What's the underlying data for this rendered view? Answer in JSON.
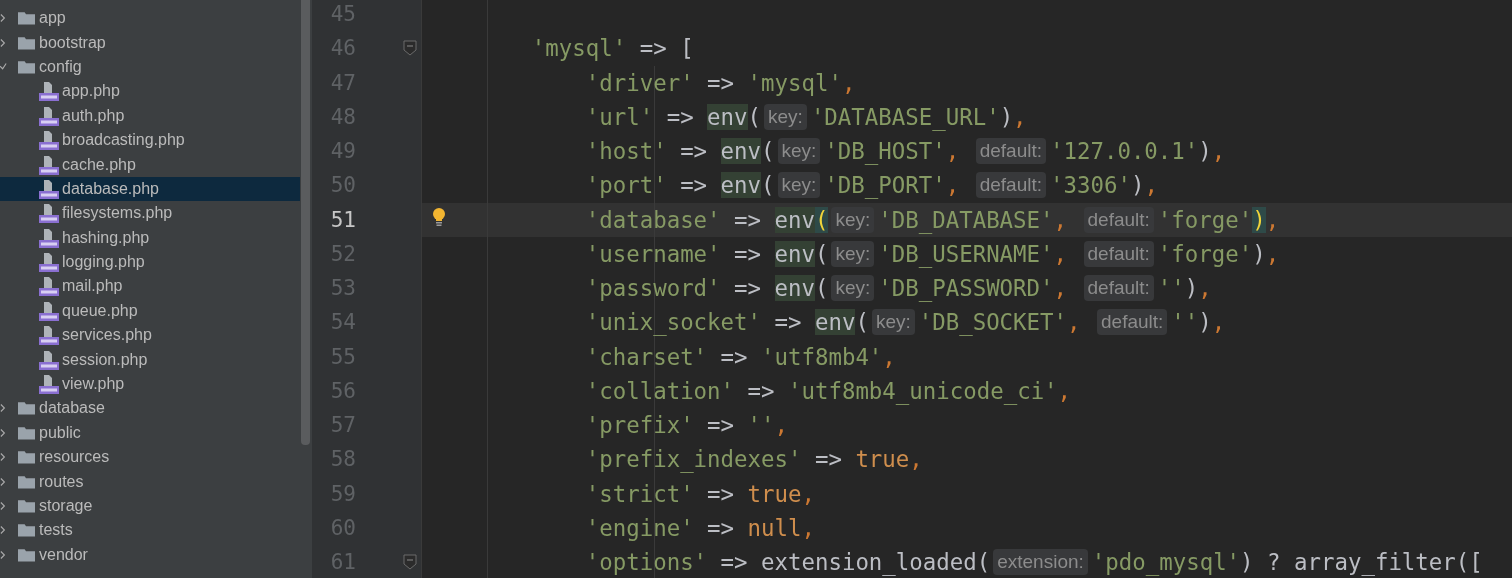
{
  "project_tree": {
    "items": [
      {
        "kind": "folder",
        "label": "app",
        "expanded": false,
        "selected": false
      },
      {
        "kind": "folder",
        "label": "bootstrap",
        "expanded": false,
        "selected": false
      },
      {
        "kind": "folder",
        "label": "config",
        "expanded": true,
        "selected": false,
        "children": [
          {
            "kind": "file",
            "label": "app.php",
            "selected": false
          },
          {
            "kind": "file",
            "label": "auth.php",
            "selected": false
          },
          {
            "kind": "file",
            "label": "broadcasting.php",
            "selected": false
          },
          {
            "kind": "file",
            "label": "cache.php",
            "selected": false
          },
          {
            "kind": "file",
            "label": "database.php",
            "selected": true
          },
          {
            "kind": "file",
            "label": "filesystems.php",
            "selected": false
          },
          {
            "kind": "file",
            "label": "hashing.php",
            "selected": false
          },
          {
            "kind": "file",
            "label": "logging.php",
            "selected": false
          },
          {
            "kind": "file",
            "label": "mail.php",
            "selected": false
          },
          {
            "kind": "file",
            "label": "queue.php",
            "selected": false
          },
          {
            "kind": "file",
            "label": "services.php",
            "selected": false
          },
          {
            "kind": "file",
            "label": "session.php",
            "selected": false
          },
          {
            "kind": "file",
            "label": "view.php",
            "selected": false
          }
        ]
      },
      {
        "kind": "folder",
        "label": "database",
        "expanded": false,
        "selected": false
      },
      {
        "kind": "folder",
        "label": "public",
        "expanded": false,
        "selected": false
      },
      {
        "kind": "folder",
        "label": "resources",
        "expanded": false,
        "selected": false
      },
      {
        "kind": "folder",
        "label": "routes",
        "expanded": false,
        "selected": false
      },
      {
        "kind": "folder",
        "label": "storage",
        "expanded": false,
        "selected": false
      },
      {
        "kind": "folder",
        "label": "tests",
        "expanded": false,
        "selected": false
      },
      {
        "kind": "folder",
        "label": "vendor",
        "expanded": false,
        "selected": false
      }
    ]
  },
  "editor": {
    "lines": [
      {
        "number": "45",
        "current": false,
        "fold_marker": false,
        "bulb": false
      },
      {
        "number": "46",
        "current": false,
        "fold_marker": true,
        "bulb": false,
        "tokens": [
          {
            "kind": "string",
            "text": "        'mysql'"
          },
          {
            "kind": "plain",
            "text": " => ["
          }
        ]
      },
      {
        "number": "47",
        "current": false,
        "fold_marker": false,
        "bulb": false,
        "tokens": [
          {
            "kind": "string",
            "text": "            'driver'"
          },
          {
            "kind": "plain",
            "text": " => "
          },
          {
            "kind": "string",
            "text": "'mysql'"
          },
          {
            "kind": "comma",
            "text": ","
          }
        ]
      },
      {
        "number": "48",
        "current": false,
        "fold_marker": false,
        "bulb": false,
        "tokens": [
          {
            "kind": "string",
            "text": "            'url'"
          },
          {
            "kind": "plain",
            "text": " => "
          },
          {
            "kind": "call",
            "text": "env",
            "highlighted": true
          },
          {
            "kind": "bracket",
            "text": "(",
            "matched": false
          },
          {
            "kind": "hint",
            "text": "key:"
          },
          {
            "kind": "string",
            "text": "'DATABASE_URL'"
          },
          {
            "kind": "bracket",
            "text": ")",
            "matched": false
          },
          {
            "kind": "comma",
            "text": ","
          }
        ]
      },
      {
        "number": "49",
        "current": false,
        "fold_marker": false,
        "bulb": false,
        "tokens": [
          {
            "kind": "string",
            "text": "            'host'"
          },
          {
            "kind": "plain",
            "text": " => "
          },
          {
            "kind": "call",
            "text": "env",
            "highlighted": true
          },
          {
            "kind": "bracket",
            "text": "(",
            "matched": false
          },
          {
            "kind": "hint",
            "text": "key:"
          },
          {
            "kind": "string",
            "text": "'DB_HOST'"
          },
          {
            "kind": "comma",
            "text": ", "
          },
          {
            "kind": "hint",
            "text": "default:"
          },
          {
            "kind": "string",
            "text": "'127.0.0.1'"
          },
          {
            "kind": "bracket",
            "text": ")",
            "matched": false
          },
          {
            "kind": "comma",
            "text": ","
          }
        ]
      },
      {
        "number": "50",
        "current": false,
        "fold_marker": false,
        "bulb": false,
        "tokens": [
          {
            "kind": "string",
            "text": "            'port'"
          },
          {
            "kind": "plain",
            "text": " => "
          },
          {
            "kind": "call",
            "text": "env",
            "highlighted": true
          },
          {
            "kind": "bracket",
            "text": "(",
            "matched": false
          },
          {
            "kind": "hint",
            "text": "key:"
          },
          {
            "kind": "string",
            "text": "'DB_PORT'"
          },
          {
            "kind": "comma",
            "text": ", "
          },
          {
            "kind": "hint",
            "text": "default:"
          },
          {
            "kind": "string",
            "text": "'3306'"
          },
          {
            "kind": "bracket",
            "text": ")",
            "matched": false
          },
          {
            "kind": "comma",
            "text": ","
          }
        ]
      },
      {
        "number": "51",
        "current": true,
        "fold_marker": false,
        "bulb": true,
        "tokens": [
          {
            "kind": "string",
            "text": "            'database'"
          },
          {
            "kind": "plain",
            "text": " => "
          },
          {
            "kind": "call",
            "text": "env",
            "highlighted": true
          },
          {
            "kind": "bracket",
            "text": "(",
            "matched": true
          },
          {
            "kind": "hint",
            "text": "key:"
          },
          {
            "kind": "string",
            "text": "'DB_DATABASE'"
          },
          {
            "kind": "comma",
            "text": ", "
          },
          {
            "kind": "hint",
            "text": "default:"
          },
          {
            "kind": "string",
            "text": "'forge'"
          },
          {
            "kind": "bracket",
            "text": ")",
            "matched": true
          },
          {
            "kind": "comma",
            "text": ","
          }
        ]
      },
      {
        "number": "52",
        "current": false,
        "fold_marker": false,
        "bulb": false,
        "tokens": [
          {
            "kind": "string",
            "text": "            'username'"
          },
          {
            "kind": "plain",
            "text": " => "
          },
          {
            "kind": "call",
            "text": "env",
            "highlighted": true
          },
          {
            "kind": "bracket",
            "text": "(",
            "matched": false
          },
          {
            "kind": "hint",
            "text": "key:"
          },
          {
            "kind": "string",
            "text": "'DB_USERNAME'"
          },
          {
            "kind": "comma",
            "text": ", "
          },
          {
            "kind": "hint",
            "text": "default:"
          },
          {
            "kind": "string",
            "text": "'forge'"
          },
          {
            "kind": "bracket",
            "text": ")",
            "matched": false
          },
          {
            "kind": "comma",
            "text": ","
          }
        ]
      },
      {
        "number": "53",
        "current": false,
        "fold_marker": false,
        "bulb": false,
        "tokens": [
          {
            "kind": "string",
            "text": "            'password'"
          },
          {
            "kind": "plain",
            "text": " => "
          },
          {
            "kind": "call",
            "text": "env",
            "highlighted": true
          },
          {
            "kind": "bracket",
            "text": "(",
            "matched": false
          },
          {
            "kind": "hint",
            "text": "key:"
          },
          {
            "kind": "string",
            "text": "'DB_PASSWORD'"
          },
          {
            "kind": "comma",
            "text": ", "
          },
          {
            "kind": "hint",
            "text": "default:"
          },
          {
            "kind": "string",
            "text": "''"
          },
          {
            "kind": "bracket",
            "text": ")",
            "matched": false
          },
          {
            "kind": "comma",
            "text": ","
          }
        ]
      },
      {
        "number": "54",
        "current": false,
        "fold_marker": false,
        "bulb": false,
        "tokens": [
          {
            "kind": "string",
            "text": "            'unix_socket'"
          },
          {
            "kind": "plain",
            "text": " => "
          },
          {
            "kind": "call",
            "text": "env",
            "highlighted": true
          },
          {
            "kind": "bracket",
            "text": "(",
            "matched": false
          },
          {
            "kind": "hint",
            "text": "key:"
          },
          {
            "kind": "string",
            "text": "'DB_SOCKET'"
          },
          {
            "kind": "comma",
            "text": ", "
          },
          {
            "kind": "hint",
            "text": "default:"
          },
          {
            "kind": "string",
            "text": "''"
          },
          {
            "kind": "bracket",
            "text": ")",
            "matched": false
          },
          {
            "kind": "comma",
            "text": ","
          }
        ]
      },
      {
        "number": "55",
        "current": false,
        "fold_marker": false,
        "bulb": false,
        "tokens": [
          {
            "kind": "string",
            "text": "            'charset'"
          },
          {
            "kind": "plain",
            "text": " => "
          },
          {
            "kind": "string",
            "text": "'utf8mb4'"
          },
          {
            "kind": "comma",
            "text": ","
          }
        ]
      },
      {
        "number": "56",
        "current": false,
        "fold_marker": false,
        "bulb": false,
        "tokens": [
          {
            "kind": "string",
            "text": "            'collation'"
          },
          {
            "kind": "plain",
            "text": " => "
          },
          {
            "kind": "string",
            "text": "'utf8mb4_unicode_ci'"
          },
          {
            "kind": "comma",
            "text": ","
          }
        ]
      },
      {
        "number": "57",
        "current": false,
        "fold_marker": false,
        "bulb": false,
        "tokens": [
          {
            "kind": "string",
            "text": "            'prefix'"
          },
          {
            "kind": "plain",
            "text": " => "
          },
          {
            "kind": "string",
            "text": "''"
          },
          {
            "kind": "comma",
            "text": ","
          }
        ]
      },
      {
        "number": "58",
        "current": false,
        "fold_marker": false,
        "bulb": false,
        "tokens": [
          {
            "kind": "string",
            "text": "            'prefix_indexes'"
          },
          {
            "kind": "plain",
            "text": " => "
          },
          {
            "kind": "keyword",
            "text": "true"
          },
          {
            "kind": "comma",
            "text": ","
          }
        ]
      },
      {
        "number": "59",
        "current": false,
        "fold_marker": false,
        "bulb": false,
        "tokens": [
          {
            "kind": "string",
            "text": "            'strict'"
          },
          {
            "kind": "plain",
            "text": " => "
          },
          {
            "kind": "keyword",
            "text": "true"
          },
          {
            "kind": "comma",
            "text": ","
          }
        ]
      },
      {
        "number": "60",
        "current": false,
        "fold_marker": false,
        "bulb": false,
        "tokens": [
          {
            "kind": "string",
            "text": "            'engine'"
          },
          {
            "kind": "plain",
            "text": " => "
          },
          {
            "kind": "keyword",
            "text": "null"
          },
          {
            "kind": "comma",
            "text": ","
          }
        ]
      },
      {
        "number": "61",
        "current": false,
        "fold_marker": true,
        "bulb": false,
        "tokens": [
          {
            "kind": "string",
            "text": "            'options'"
          },
          {
            "kind": "plain",
            "text": " => extension_loaded"
          },
          {
            "kind": "bracket",
            "text": "(",
            "matched": false
          },
          {
            "kind": "hint",
            "text": "extension:"
          },
          {
            "kind": "string",
            "text": "'pdo_mysql'"
          },
          {
            "kind": "plain",
            "text": ") ? array_filter(["
          }
        ]
      }
    ]
  }
}
